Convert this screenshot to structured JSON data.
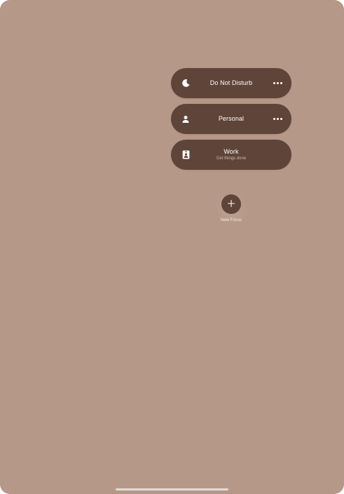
{
  "focus_modes": [
    {
      "label": "Do Not Disturb",
      "subtitle": "",
      "icon": "moon-icon",
      "has_more": true
    },
    {
      "label": "Personal",
      "subtitle": "",
      "icon": "person-icon",
      "has_more": true
    },
    {
      "label": "Work",
      "subtitle": "Get things done",
      "icon": "id-badge-icon",
      "has_more": false
    }
  ],
  "new_focus": {
    "label": "New Focus",
    "icon": "plus-icon"
  },
  "colors": {
    "background": "#b59888",
    "pill": "#5f4439",
    "text": "#ffffff"
  }
}
